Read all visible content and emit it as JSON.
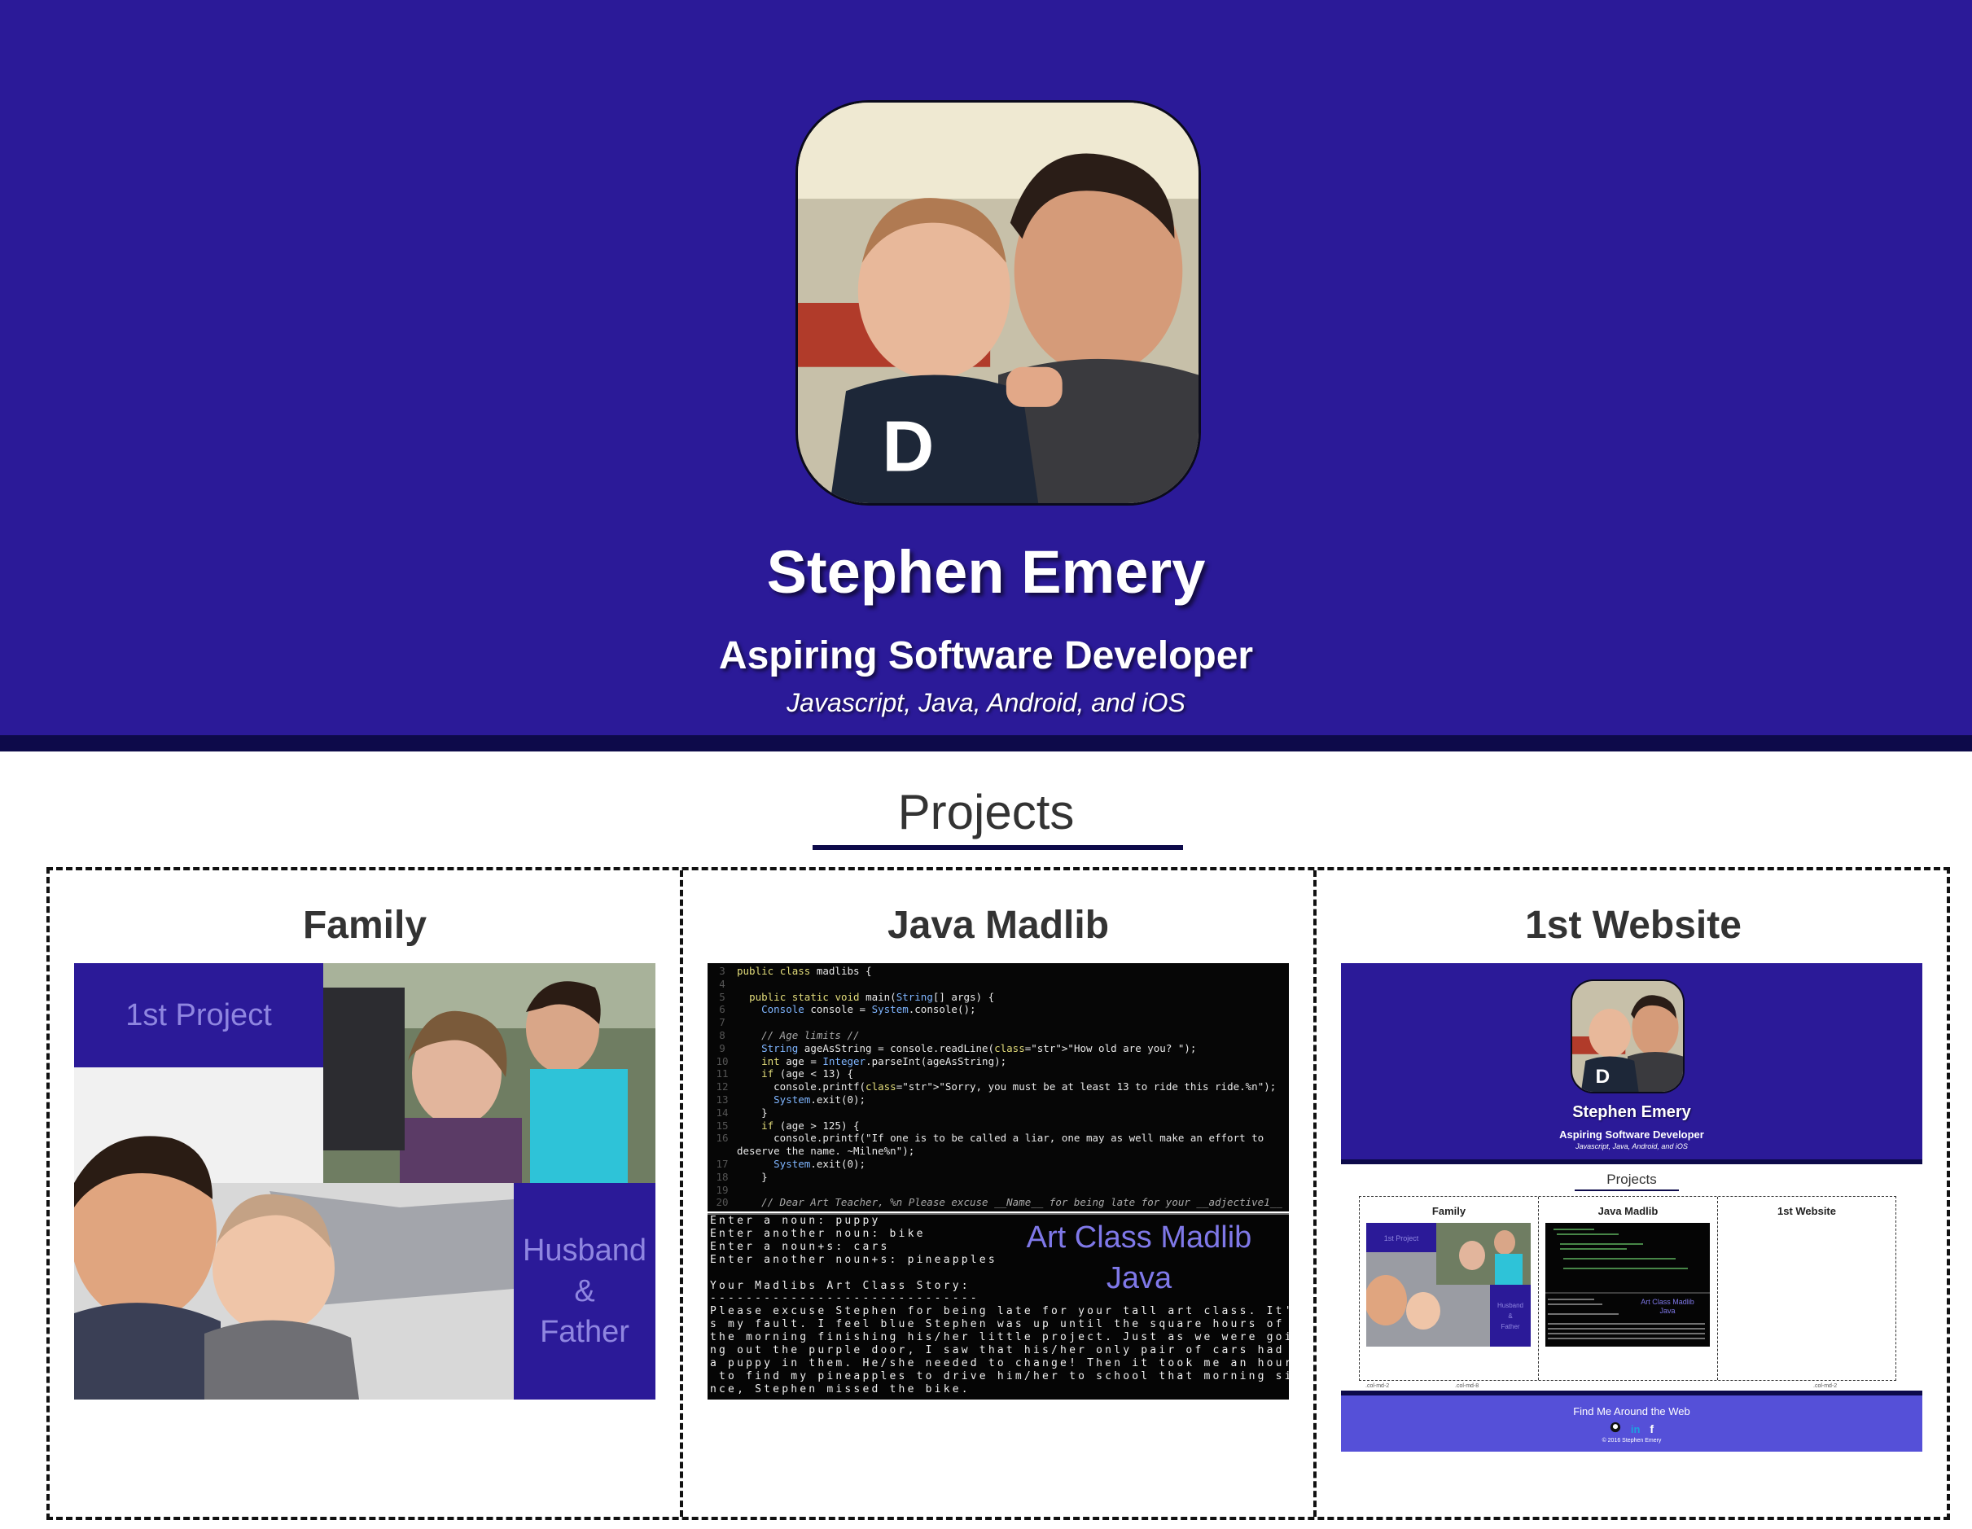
{
  "header": {
    "name": "Stephen Emery",
    "role": "Aspiring Software Developer",
    "skills": "Javascript, Java, Android, and iOS",
    "bg_color": "#2b1a98",
    "bar_color": "#0d0a4a"
  },
  "projects": {
    "title": "Projects",
    "items": [
      {
        "title": "Family",
        "labels": [
          "1st Project",
          "Husband",
          "&",
          "Father"
        ]
      },
      {
        "title": "Java Madlib",
        "code_lines": [
          {
            "n": "3",
            "text": "public class madlibs {"
          },
          {
            "n": "4",
            "text": ""
          },
          {
            "n": "5",
            "text": "  public static void main(String[] args) {"
          },
          {
            "n": "6",
            "text": "    Console console = System.console();"
          },
          {
            "n": "7",
            "text": ""
          },
          {
            "n": "8",
            "text": "    // Age limits //"
          },
          {
            "n": "9",
            "text": "    String ageAsString = console.readLine(\"How old are you? \");"
          },
          {
            "n": "10",
            "text": "    int age = Integer.parseInt(ageAsString);"
          },
          {
            "n": "11",
            "text": "    if (age < 13) {"
          },
          {
            "n": "12",
            "text": "      console.printf(\"Sorry, you must be at least 13 to ride this ride.%n\");"
          },
          {
            "n": "13",
            "text": "      System.exit(0);"
          },
          {
            "n": "14",
            "text": "    }"
          },
          {
            "n": "15",
            "text": "    if (age > 125) {"
          },
          {
            "n": "16",
            "text": "      console.printf(\"If one is to be called a liar, one may as well make an effort to"
          },
          {
            "n": "",
            "text": "deserve the name. ~Milne%n\");"
          },
          {
            "n": "17",
            "text": "      System.exit(0);"
          },
          {
            "n": "18",
            "text": "    }"
          },
          {
            "n": "19",
            "text": ""
          },
          {
            "n": "20",
            "text": "    // Dear Art Teacher, %n Please excuse __Name__ for being late for your __adjective1__"
          }
        ],
        "console_text": "Enter a noun: puppy\nEnter another noun: bike\nEnter a noun+s: cars\nEnter another noun+s: pineapples\n\nYour Madlibs Art Class Story:\n------------------------------\nPlease excuse Stephen for being late for your tall art class. It'\ns my fault. I feel blue Stephen was up until the square hours of\nthe morning finishing his/her little project. Just as we were goi\nng out the purple door, I saw that his/her only pair of cars had\na puppy in them. He/she needed to change! Then it took me an hour\n to find my pineapples to drive him/her to school that morning si\nnce, Stephen missed the bike.",
        "label_line1": "Art Class Madlib",
        "label_line2": "Java"
      },
      {
        "title": "1st Website",
        "site_name": "Stephen Emery",
        "site_role": "Aspiring Software Developer",
        "site_skills": "Javascript, Java, Android, and iOS",
        "site_projects": "Projects",
        "site_cols": [
          "Family",
          "Java Madlib",
          "1st Website"
        ],
        "site_fam_labels": [
          "1st Project",
          "Husband",
          "&",
          "Father"
        ],
        "site_java_labels": [
          "Art Class Madlib",
          "Java"
        ],
        "site_col_notes": [
          ".col-md-2",
          ".col-md-8",
          ".col-md-2"
        ],
        "site_find": "Find Me Around the Web",
        "site_icons": [
          "github-icon",
          "linkedin-icon",
          "facebook-icon"
        ],
        "site_copyright": "© 2016 Stephen Emery"
      }
    ]
  }
}
